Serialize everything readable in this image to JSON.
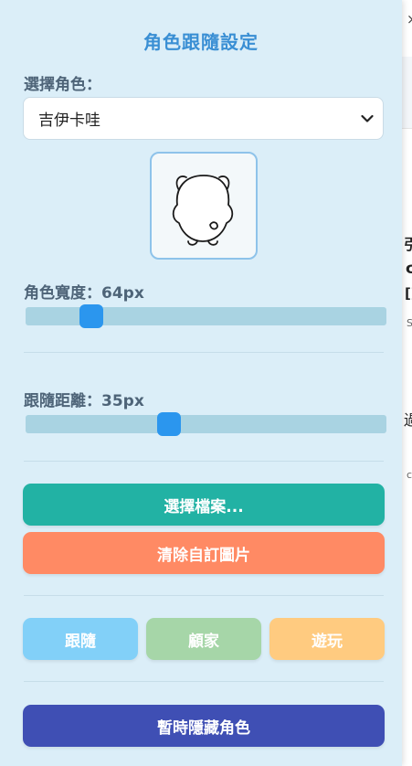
{
  "panel": {
    "title": "角色跟隨設定",
    "character_label": "選擇角色：",
    "character_selected": "吉伊卡哇",
    "width_label": "角色寬度：",
    "width_value": "64px",
    "width_level": 0.16,
    "distance_label": "跟隨距離：",
    "distance_value": "35px",
    "distance_level": 0.39,
    "choose_file": "選擇檔案...",
    "clear_image": "清除自訂圖片",
    "modes": [
      "跟隨",
      "顧家",
      "遊玩"
    ],
    "hide_button": "暫時隱藏角色"
  },
  "colors": {
    "panel_bg": "#dbeef8",
    "title": "#3a8fd4",
    "choose_file": "#22b2a4",
    "clear_image": "#ff8a64",
    "mode_follow": "#82d0f8",
    "mode_home": "#a6d6a8",
    "mode_play": "#ffcb80",
    "hide": "#3f4fb4",
    "slider_thumb": "#2b96ee"
  },
  "background_page": {
    "close": "×",
    "fragments": [
      "引",
      "c",
      "[]",
      "S",
      "過",
      "c"
    ]
  }
}
